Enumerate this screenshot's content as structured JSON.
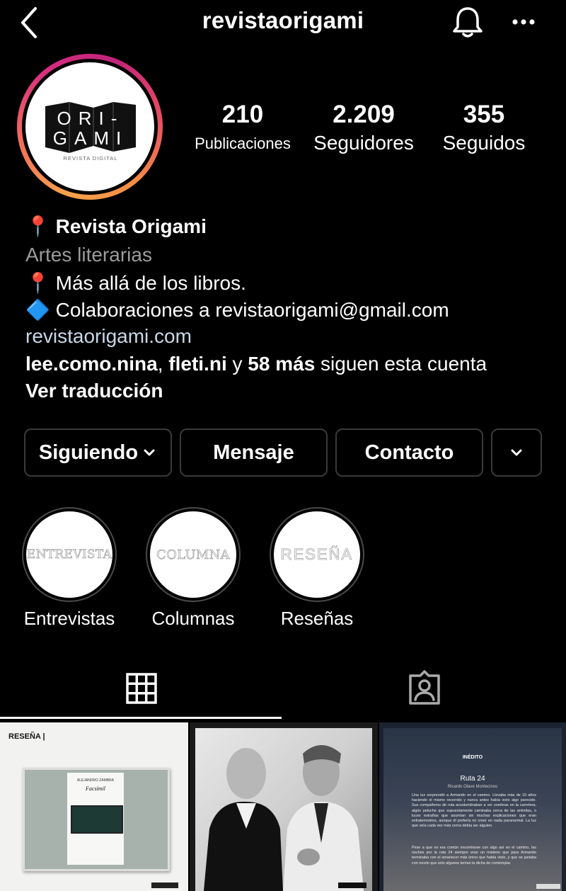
{
  "header": {
    "username": "revistaorigami",
    "back_icon": "chevron-left-icon",
    "bell_icon": "bell-icon",
    "more_icon": "more-horizontal-icon"
  },
  "avatar": {
    "line1": "ORI-",
    "line2": "GAMI",
    "caption": "REVISTA DIGITAL"
  },
  "stats": [
    {
      "value": "210",
      "label": "Publicaciones"
    },
    {
      "value": "2.209",
      "label": "Seguidores"
    },
    {
      "value": "355",
      "label": "Seguidos"
    }
  ],
  "bio": {
    "pin_icon": "📍",
    "name": "Revista Origami",
    "category": "Artes literarias",
    "line1": "Más allá de los libros.",
    "diamond_icon": "🔷",
    "line2": "Colaboraciones a revistaorigami@gmail.com",
    "website": "revistaorigami.com",
    "followed_by_1": "lee.como.nina",
    "followed_by_sep1": ", ",
    "followed_by_2": "fleti.ni",
    "followed_by_sep2": " y ",
    "followed_by_more": "58 más",
    "followed_by_suffix": " siguen esta cuenta",
    "translate": "Ver traducción"
  },
  "actions": {
    "following": "Siguiendo",
    "message": "Mensaje",
    "contact": "Contacto"
  },
  "highlights": [
    {
      "cover_text": "ENTREVISTA",
      "label": "Entrevistas"
    },
    {
      "cover_text": "COLUMNA",
      "label": "Columnas"
    },
    {
      "cover_text": "RESEÑA",
      "label": "Reseñas"
    }
  ],
  "tabs": {
    "grid_icon": "grid-icon",
    "tagged_icon": "tagged-person-icon"
  },
  "posts": {
    "post1": {
      "tag": "RESEÑA |",
      "book_author": "ALEJANDRO ZAMBRA",
      "book_title": "Facsímil"
    },
    "post3": {
      "kicker": "INÉDITO",
      "title": "Ruta 24",
      "author": "Ricardo Olave Montecinos",
      "para1": "Una luz sorprendió a Armando en el camino. Llevaba más de 10 años haciendo el mismo recorrido y nunca antes había visto algo parecido. Sus compañeros de ruta acostumbraban a ver sombras en la carretera, algún peluche que supuestamente caminaba cerca de las animitas, o luces extrañas que asumían sin muchas explicaciones que eran extraterrestres, aunque él prefería no creer en nada paranormal. La luz que veía cada vez más cerca debía ser alguien.",
      "para2": "Pese a que no era común encontrarse con algo así en el camino, las noches por la ruta 24 siempre eran un misterio que para Armando terminaba con el amanecer más único que había visto, y que se jactaba con recelo que solo algunos tenían la dicha de contemplar."
    }
  }
}
